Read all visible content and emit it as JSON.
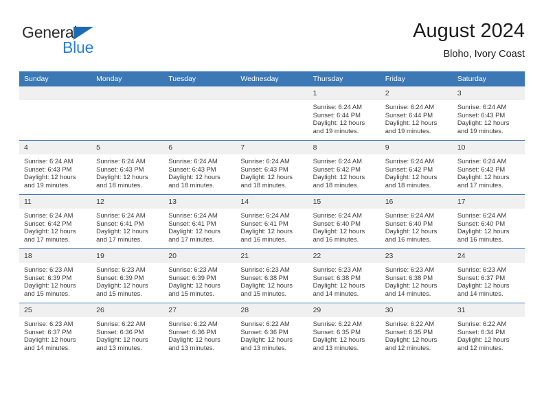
{
  "brand": {
    "name_part1": "General",
    "name_part2": "Blue",
    "triangle_color": "#1b6cb5",
    "blue_color": "#2a7fd4"
  },
  "header": {
    "month_title": "August 2024",
    "location": "Bloho, Ivory Coast",
    "accent_color": "#3b78b5"
  },
  "weekday_headers": [
    "Sunday",
    "Monday",
    "Tuesday",
    "Wednesday",
    "Thursday",
    "Friday",
    "Saturday"
  ],
  "labels": {
    "sunrise_prefix": "Sunrise:",
    "sunset_prefix": "Sunset:",
    "daylight_prefix": "Daylight:"
  },
  "weeks": [
    [
      {
        "day": "",
        "sunrise": "",
        "sunset": "",
        "daylight_line1": "",
        "daylight_line2": "",
        "empty": true
      },
      {
        "day": "",
        "sunrise": "",
        "sunset": "",
        "daylight_line1": "",
        "daylight_line2": "",
        "empty": true
      },
      {
        "day": "",
        "sunrise": "",
        "sunset": "",
        "daylight_line1": "",
        "daylight_line2": "",
        "empty": true
      },
      {
        "day": "",
        "sunrise": "",
        "sunset": "",
        "daylight_line1": "",
        "daylight_line2": "",
        "empty": true
      },
      {
        "day": "1",
        "sunrise": "Sunrise: 6:24 AM",
        "sunset": "Sunset: 6:44 PM",
        "daylight_line1": "Daylight: 12 hours",
        "daylight_line2": "and 19 minutes.",
        "empty": false
      },
      {
        "day": "2",
        "sunrise": "Sunrise: 6:24 AM",
        "sunset": "Sunset: 6:44 PM",
        "daylight_line1": "Daylight: 12 hours",
        "daylight_line2": "and 19 minutes.",
        "empty": false
      },
      {
        "day": "3",
        "sunrise": "Sunrise: 6:24 AM",
        "sunset": "Sunset: 6:43 PM",
        "daylight_line1": "Daylight: 12 hours",
        "daylight_line2": "and 19 minutes.",
        "empty": false
      }
    ],
    [
      {
        "day": "4",
        "sunrise": "Sunrise: 6:24 AM",
        "sunset": "Sunset: 6:43 PM",
        "daylight_line1": "Daylight: 12 hours",
        "daylight_line2": "and 19 minutes.",
        "empty": false
      },
      {
        "day": "5",
        "sunrise": "Sunrise: 6:24 AM",
        "sunset": "Sunset: 6:43 PM",
        "daylight_line1": "Daylight: 12 hours",
        "daylight_line2": "and 18 minutes.",
        "empty": false
      },
      {
        "day": "6",
        "sunrise": "Sunrise: 6:24 AM",
        "sunset": "Sunset: 6:43 PM",
        "daylight_line1": "Daylight: 12 hours",
        "daylight_line2": "and 18 minutes.",
        "empty": false
      },
      {
        "day": "7",
        "sunrise": "Sunrise: 6:24 AM",
        "sunset": "Sunset: 6:43 PM",
        "daylight_line1": "Daylight: 12 hours",
        "daylight_line2": "and 18 minutes.",
        "empty": false
      },
      {
        "day": "8",
        "sunrise": "Sunrise: 6:24 AM",
        "sunset": "Sunset: 6:42 PM",
        "daylight_line1": "Daylight: 12 hours",
        "daylight_line2": "and 18 minutes.",
        "empty": false
      },
      {
        "day": "9",
        "sunrise": "Sunrise: 6:24 AM",
        "sunset": "Sunset: 6:42 PM",
        "daylight_line1": "Daylight: 12 hours",
        "daylight_line2": "and 18 minutes.",
        "empty": false
      },
      {
        "day": "10",
        "sunrise": "Sunrise: 6:24 AM",
        "sunset": "Sunset: 6:42 PM",
        "daylight_line1": "Daylight: 12 hours",
        "daylight_line2": "and 17 minutes.",
        "empty": false
      }
    ],
    [
      {
        "day": "11",
        "sunrise": "Sunrise: 6:24 AM",
        "sunset": "Sunset: 6:42 PM",
        "daylight_line1": "Daylight: 12 hours",
        "daylight_line2": "and 17 minutes.",
        "empty": false
      },
      {
        "day": "12",
        "sunrise": "Sunrise: 6:24 AM",
        "sunset": "Sunset: 6:41 PM",
        "daylight_line1": "Daylight: 12 hours",
        "daylight_line2": "and 17 minutes.",
        "empty": false
      },
      {
        "day": "13",
        "sunrise": "Sunrise: 6:24 AM",
        "sunset": "Sunset: 6:41 PM",
        "daylight_line1": "Daylight: 12 hours",
        "daylight_line2": "and 17 minutes.",
        "empty": false
      },
      {
        "day": "14",
        "sunrise": "Sunrise: 6:24 AM",
        "sunset": "Sunset: 6:41 PM",
        "daylight_line1": "Daylight: 12 hours",
        "daylight_line2": "and 16 minutes.",
        "empty": false
      },
      {
        "day": "15",
        "sunrise": "Sunrise: 6:24 AM",
        "sunset": "Sunset: 6:40 PM",
        "daylight_line1": "Daylight: 12 hours",
        "daylight_line2": "and 16 minutes.",
        "empty": false
      },
      {
        "day": "16",
        "sunrise": "Sunrise: 6:24 AM",
        "sunset": "Sunset: 6:40 PM",
        "daylight_line1": "Daylight: 12 hours",
        "daylight_line2": "and 16 minutes.",
        "empty": false
      },
      {
        "day": "17",
        "sunrise": "Sunrise: 6:24 AM",
        "sunset": "Sunset: 6:40 PM",
        "daylight_line1": "Daylight: 12 hours",
        "daylight_line2": "and 16 minutes.",
        "empty": false
      }
    ],
    [
      {
        "day": "18",
        "sunrise": "Sunrise: 6:23 AM",
        "sunset": "Sunset: 6:39 PM",
        "daylight_line1": "Daylight: 12 hours",
        "daylight_line2": "and 15 minutes.",
        "empty": false
      },
      {
        "day": "19",
        "sunrise": "Sunrise: 6:23 AM",
        "sunset": "Sunset: 6:39 PM",
        "daylight_line1": "Daylight: 12 hours",
        "daylight_line2": "and 15 minutes.",
        "empty": false
      },
      {
        "day": "20",
        "sunrise": "Sunrise: 6:23 AM",
        "sunset": "Sunset: 6:39 PM",
        "daylight_line1": "Daylight: 12 hours",
        "daylight_line2": "and 15 minutes.",
        "empty": false
      },
      {
        "day": "21",
        "sunrise": "Sunrise: 6:23 AM",
        "sunset": "Sunset: 6:38 PM",
        "daylight_line1": "Daylight: 12 hours",
        "daylight_line2": "and 15 minutes.",
        "empty": false
      },
      {
        "day": "22",
        "sunrise": "Sunrise: 6:23 AM",
        "sunset": "Sunset: 6:38 PM",
        "daylight_line1": "Daylight: 12 hours",
        "daylight_line2": "and 14 minutes.",
        "empty": false
      },
      {
        "day": "23",
        "sunrise": "Sunrise: 6:23 AM",
        "sunset": "Sunset: 6:38 PM",
        "daylight_line1": "Daylight: 12 hours",
        "daylight_line2": "and 14 minutes.",
        "empty": false
      },
      {
        "day": "24",
        "sunrise": "Sunrise: 6:23 AM",
        "sunset": "Sunset: 6:37 PM",
        "daylight_line1": "Daylight: 12 hours",
        "daylight_line2": "and 14 minutes.",
        "empty": false
      }
    ],
    [
      {
        "day": "25",
        "sunrise": "Sunrise: 6:23 AM",
        "sunset": "Sunset: 6:37 PM",
        "daylight_line1": "Daylight: 12 hours",
        "daylight_line2": "and 14 minutes.",
        "empty": false
      },
      {
        "day": "26",
        "sunrise": "Sunrise: 6:22 AM",
        "sunset": "Sunset: 6:36 PM",
        "daylight_line1": "Daylight: 12 hours",
        "daylight_line2": "and 13 minutes.",
        "empty": false
      },
      {
        "day": "27",
        "sunrise": "Sunrise: 6:22 AM",
        "sunset": "Sunset: 6:36 PM",
        "daylight_line1": "Daylight: 12 hours",
        "daylight_line2": "and 13 minutes.",
        "empty": false
      },
      {
        "day": "28",
        "sunrise": "Sunrise: 6:22 AM",
        "sunset": "Sunset: 6:36 PM",
        "daylight_line1": "Daylight: 12 hours",
        "daylight_line2": "and 13 minutes.",
        "empty": false
      },
      {
        "day": "29",
        "sunrise": "Sunrise: 6:22 AM",
        "sunset": "Sunset: 6:35 PM",
        "daylight_line1": "Daylight: 12 hours",
        "daylight_line2": "and 13 minutes.",
        "empty": false
      },
      {
        "day": "30",
        "sunrise": "Sunrise: 6:22 AM",
        "sunset": "Sunset: 6:35 PM",
        "daylight_line1": "Daylight: 12 hours",
        "daylight_line2": "and 12 minutes.",
        "empty": false
      },
      {
        "day": "31",
        "sunrise": "Sunrise: 6:22 AM",
        "sunset": "Sunset: 6:34 PM",
        "daylight_line1": "Daylight: 12 hours",
        "daylight_line2": "and 12 minutes.",
        "empty": false
      }
    ]
  ]
}
